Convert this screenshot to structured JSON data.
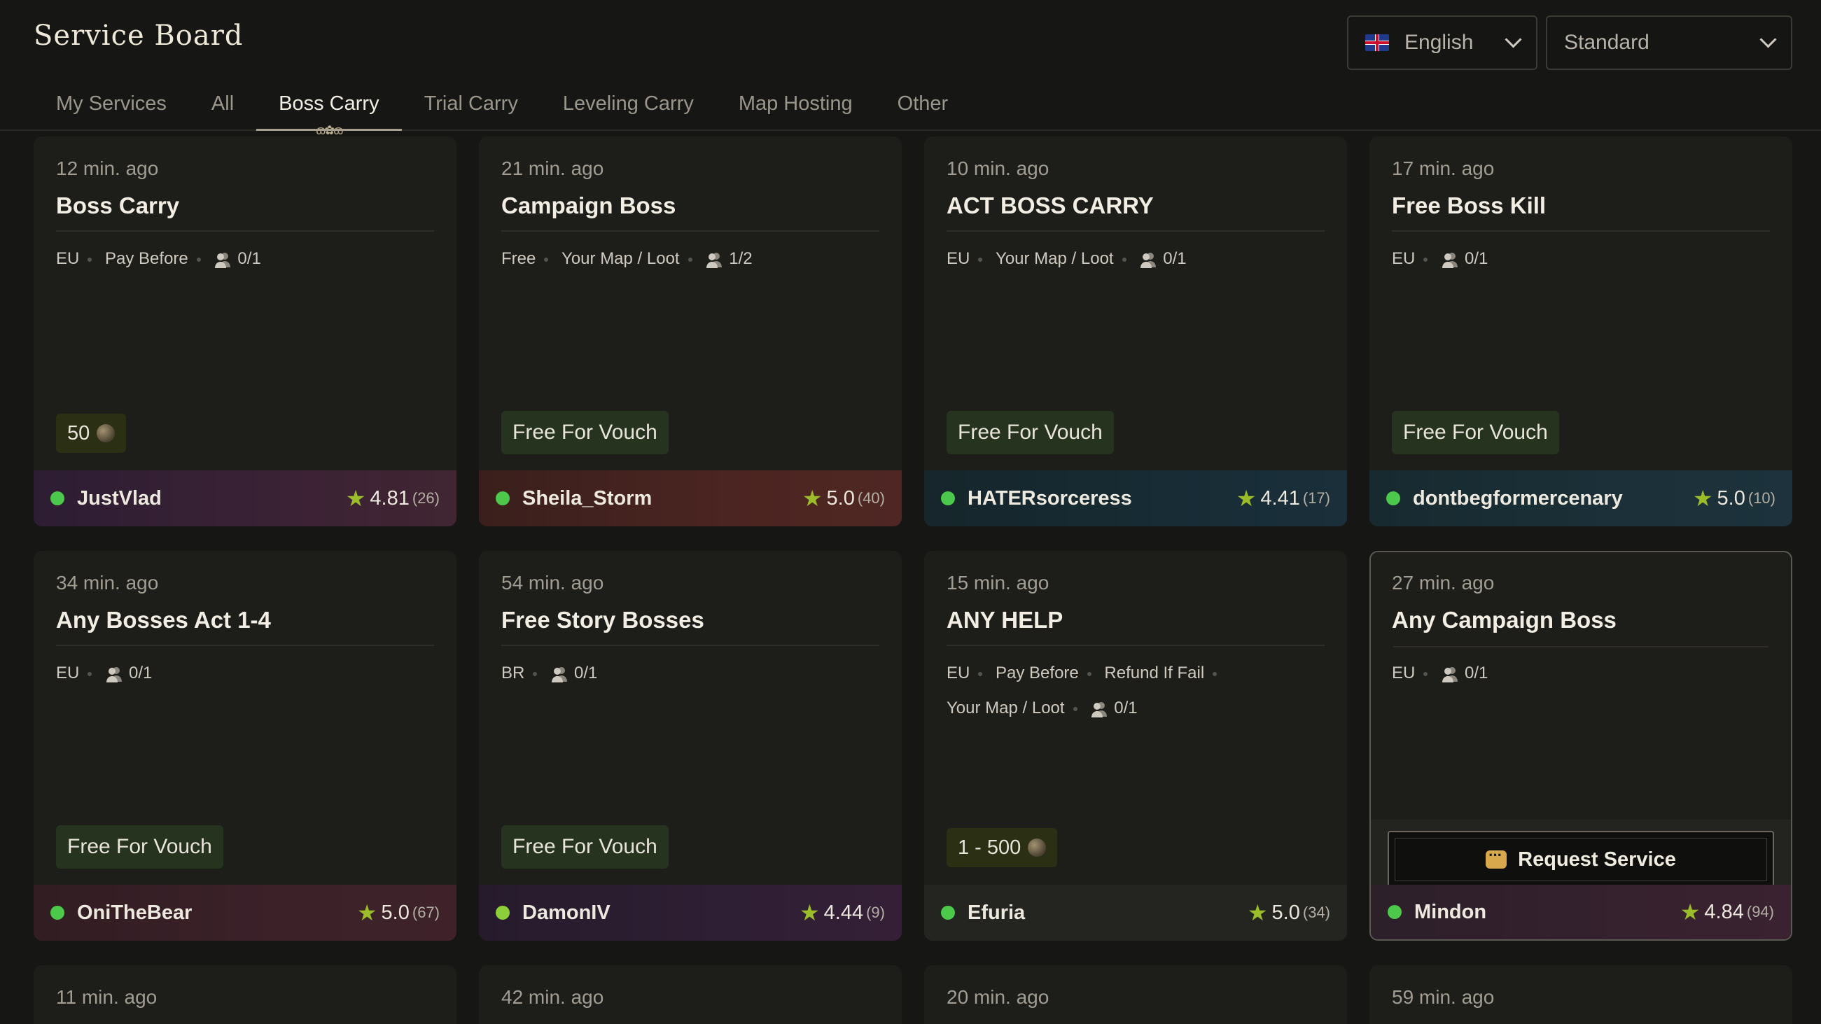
{
  "header": {
    "title": "Service Board",
    "language": "English",
    "league": "Standard"
  },
  "tabs": [
    "My Services",
    "All",
    "Boss Carry",
    "Trial Carry",
    "Leveling Carry",
    "Map Hosting",
    "Other"
  ],
  "active_tab": "Boss Carry",
  "cards": [
    {
      "time": "12 min. ago",
      "title": "Boss Carry",
      "tags": [
        "EU",
        "Pay Before"
      ],
      "slots": "0/1",
      "price": "50",
      "user": "JustVlad",
      "rating": "4.81",
      "count": "(26)"
    },
    {
      "time": "21 min. ago",
      "title": "Campaign Boss",
      "tags": [
        "Free",
        "Your Map / Loot"
      ],
      "slots": "1/2",
      "badge": "Free For Vouch",
      "user": "Sheila_Storm",
      "rating": "5.0",
      "count": "(40)"
    },
    {
      "time": "10 min. ago",
      "title": "ACT BOSS CARRY",
      "tags": [
        "EU",
        "Your Map / Loot"
      ],
      "slots": "0/1",
      "badge": "Free For Vouch",
      "user": "HATERsorceress",
      "rating": "4.41",
      "count": "(17)"
    },
    {
      "time": "17 min. ago",
      "title": "Free Boss Kill",
      "tags": [
        "EU"
      ],
      "slots": "0/1",
      "badge": "Free For Vouch",
      "user": "dontbegformercenary",
      "rating": "5.0",
      "count": "(10)"
    },
    {
      "time": "34 min. ago",
      "title": "Any Bosses Act 1-4",
      "tags": [
        "EU"
      ],
      "slots": "0/1",
      "badge": "Free For Vouch",
      "user": "OniTheBear",
      "rating": "5.0",
      "count": "(67)"
    },
    {
      "time": "54 min. ago",
      "title": "Free Story Bosses",
      "tags": [
        "BR"
      ],
      "slots": "0/1",
      "badge": "Free For Vouch",
      "user": "DamonIV",
      "rating": "4.44",
      "count": "(9)"
    },
    {
      "time": "15 min. ago",
      "title": "ANY HELP",
      "tags": [
        "EU",
        "Pay Before",
        "Refund If Fail",
        "Your Map / Loot"
      ],
      "slots": "0/1",
      "price": "1 - 500",
      "user": "Efuria",
      "rating": "5.0",
      "count": "(34)"
    },
    {
      "time": "27 min. ago",
      "title": "Any Campaign Boss",
      "tags": [
        "EU"
      ],
      "slots": "0/1",
      "request_label": "Request Service",
      "user": "Mindon",
      "rating": "4.84",
      "count": "(94)"
    },
    {
      "time": "11 min. ago"
    },
    {
      "time": "42 min. ago"
    },
    {
      "time": "20 min. ago"
    },
    {
      "time": "59 min. ago"
    }
  ],
  "colors": {
    "online": "#4cc84a",
    "star": "#9bbd2a",
    "badge_bg": "#25331f"
  }
}
